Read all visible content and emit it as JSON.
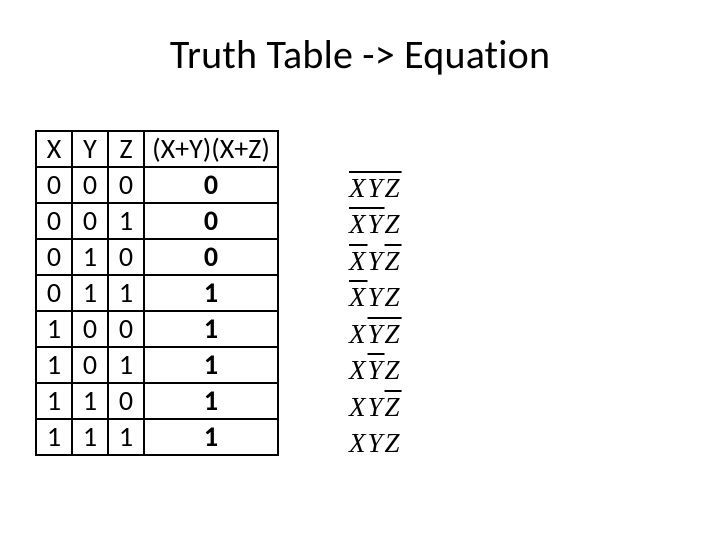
{
  "title": "Truth Table -> Equation",
  "chart_data": {
    "type": "table",
    "columns": [
      "X",
      "Y",
      "Z",
      "(X+Y)(X+Z)"
    ],
    "rows": [
      [
        "0",
        "0",
        "0",
        "0"
      ],
      [
        "0",
        "0",
        "1",
        "0"
      ],
      [
        "0",
        "1",
        "0",
        "0"
      ],
      [
        "0",
        "1",
        "1",
        "1"
      ],
      [
        "1",
        "0",
        "0",
        "1"
      ],
      [
        "1",
        "0",
        "1",
        "1"
      ],
      [
        "1",
        "1",
        "0",
        "1"
      ],
      [
        "1",
        "1",
        "1",
        "1"
      ]
    ]
  },
  "terms": [
    [
      {
        "t": "X",
        "bar": true
      },
      {
        "t": "Y",
        "bar": true
      },
      {
        "t": "Z",
        "bar": true
      }
    ],
    [
      {
        "t": "X",
        "bar": true
      },
      {
        "t": "Y",
        "bar": true
      },
      {
        "t": "Z",
        "bar": false
      }
    ],
    [
      {
        "t": "X",
        "bar": true
      },
      {
        "t": "Y",
        "bar": false
      },
      {
        "t": "Z",
        "bar": true
      }
    ],
    [
      {
        "t": "X",
        "bar": true
      },
      {
        "t": "Y",
        "bar": false
      },
      {
        "t": "Z",
        "bar": false
      }
    ],
    [
      {
        "t": "X",
        "bar": false
      },
      {
        "t": "Y",
        "bar": true
      },
      {
        "t": "Z",
        "bar": true
      }
    ],
    [
      {
        "t": "X",
        "bar": false
      },
      {
        "t": "Y",
        "bar": true
      },
      {
        "t": "Z",
        "bar": false
      }
    ],
    [
      {
        "t": "X",
        "bar": false
      },
      {
        "t": "Y",
        "bar": false
      },
      {
        "t": "Z",
        "bar": true
      }
    ],
    [
      {
        "t": "X",
        "bar": false
      },
      {
        "t": "Y",
        "bar": false
      },
      {
        "t": "Z",
        "bar": false
      }
    ]
  ]
}
